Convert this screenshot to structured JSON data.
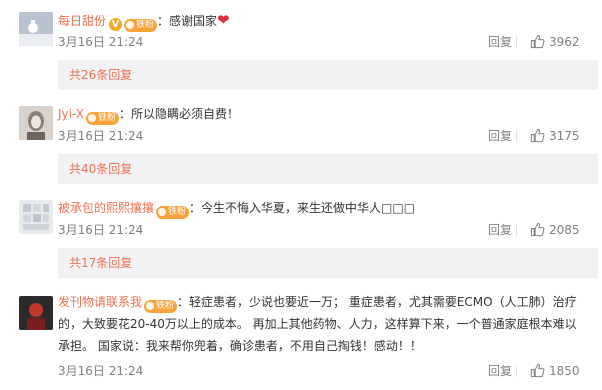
{
  "comments": [
    {
      "user": "每日甜份",
      "verified_mark": "V",
      "fan_badge": "铁粉",
      "text": "：感谢国家",
      "heart": "❤",
      "date": "3月16日 21:24",
      "reply_label": "回复",
      "likes": "3962",
      "more_replies": "共26条回复"
    },
    {
      "user": "Jyi-X",
      "fan_badge": "铁粉",
      "text": "：所以隐瞒必须自费！",
      "date": "3月16日 21:24",
      "reply_label": "回复",
      "likes": "3175",
      "more_replies": "共40条回复"
    },
    {
      "user": "被承包的熙熙攘攘",
      "fan_badge": "铁粉",
      "text": "：今生不悔入华夏，来生还做中华人□□□",
      "date": "3月16日 21:24",
      "reply_label": "回复",
      "likes": "2085",
      "more_replies": "共17条回复"
    },
    {
      "user": "发刊物请联系我",
      "fan_badge": "铁粉",
      "text_line1": "：轻症患者，少说也要近一万；  重症患者，尤其需要ECMO（人工肺）治疗",
      "text_line2": "的，大致要花20-40万以上的成本。 再加上其他药物、人力，这样算下来，一个普通家庭根本难以",
      "text_line3": "承担。  国家说：我来帮你兜着，确诊患者，不用自己掏钱！感动！！",
      "date": "3月16日 21:24",
      "reply_label": "回复",
      "likes": "1850"
    }
  ],
  "colors": {
    "username": "#eb7350",
    "meta": "#808080",
    "more_bg": "#f2f2f5",
    "heart": "#e0303a",
    "fan_badge": "#f7a23a"
  }
}
